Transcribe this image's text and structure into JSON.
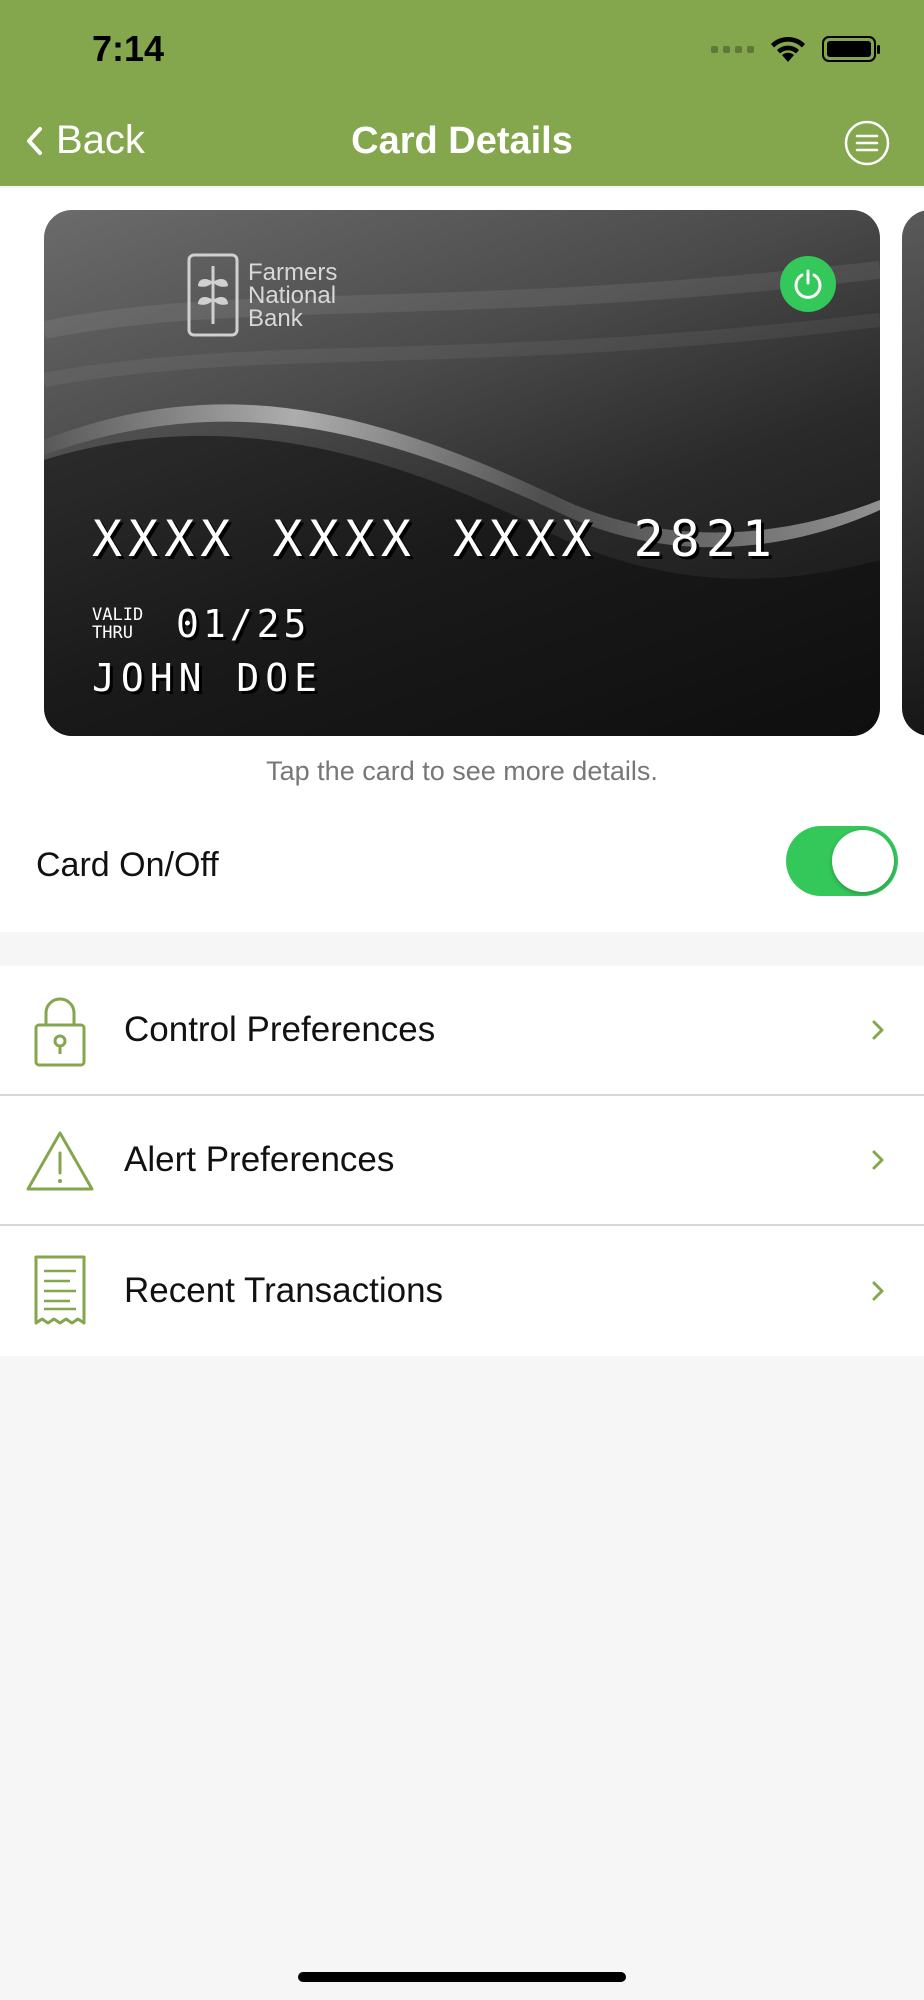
{
  "status_bar": {
    "time": "7:14"
  },
  "nav": {
    "back_label": "Back",
    "title": "Card Details"
  },
  "card": {
    "bank_name_line1": "Farmers",
    "bank_name_line2": "National",
    "bank_name_line3": "Bank",
    "number": "XXXX XXXX XXXX 2821",
    "valid_label_line1": "VALID",
    "valid_label_line2": "THRU",
    "expiry": "01/25",
    "holder": "JOHN DOE",
    "hint": "Tap the card to see more details."
  },
  "card_toggle": {
    "label": "Card On/Off",
    "on": true
  },
  "menu": {
    "items": [
      {
        "label": "Control Preferences",
        "icon": "lock-icon"
      },
      {
        "label": "Alert Preferences",
        "icon": "warning-icon"
      },
      {
        "label": "Recent Transactions",
        "icon": "receipt-icon"
      }
    ]
  },
  "colors": {
    "brand_green": "#84a64d",
    "toggle_green": "#34c759"
  }
}
